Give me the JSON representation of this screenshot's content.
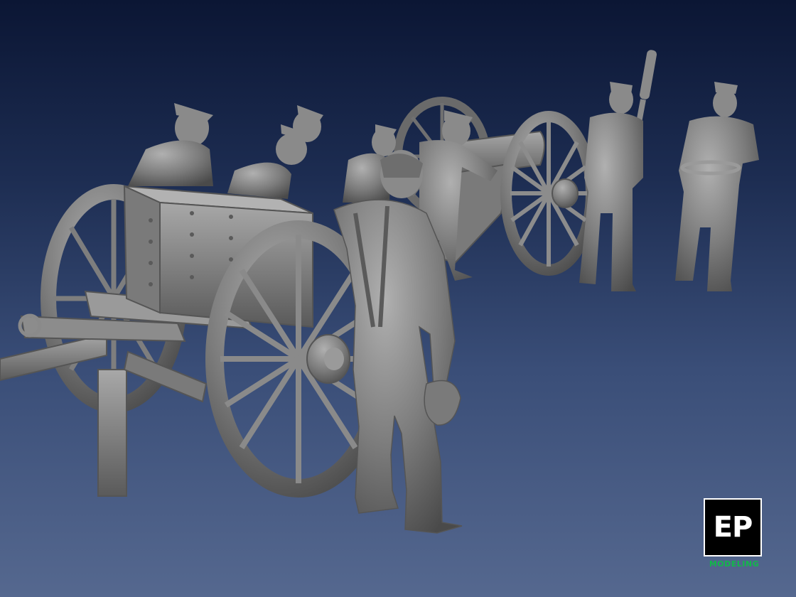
{
  "logo": {
    "letters": "EP",
    "subtitle": "MODELING",
    "box_color": "#000000",
    "letters_color": "#ffffff",
    "subtitle_color": "#12b84a"
  },
  "colors": {
    "background_top": "#0b1634",
    "background_bottom": "#55688f",
    "model_gray": "#8a8a8a"
  }
}
